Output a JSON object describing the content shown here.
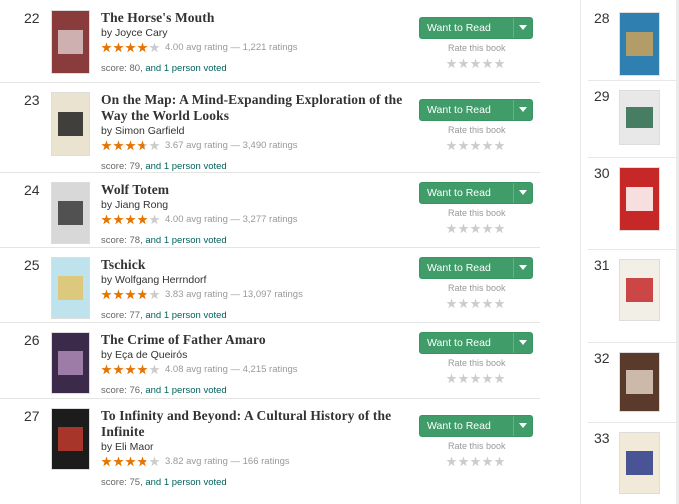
{
  "list": [
    {
      "rank": "22",
      "title": "The Horse's Mouth",
      "author": "Joyce Cary",
      "stars": 4.0,
      "rating_text": "4.00 avg rating — 1,221 ratings",
      "score": "score: 80,",
      "voted": "and 1 person voted",
      "want_label": "Want to Read",
      "rate_label": "Rate this book",
      "cover": {
        "bg": "#8a3b3b",
        "accent": "#d9c6c6",
        "text": "#ffffff"
      }
    },
    {
      "rank": "23",
      "title": "On the Map: A Mind-Expanding Exploration of the Way the World Looks",
      "author": "Simon Garfield",
      "stars": 3.67,
      "rating_text": "3.67 avg rating — 3,490 ratings",
      "score": "score: 79,",
      "voted": "and 1 person voted",
      "want_label": "Want to Read",
      "rate_label": "Rate this book",
      "cover": {
        "bg": "#e9e3cf",
        "accent": "#222222",
        "text": "#222222"
      }
    },
    {
      "rank": "24",
      "title": "Wolf Totem",
      "author": "Jiang Rong",
      "stars": 4.0,
      "rating_text": "4.00 avg rating — 3,277 ratings",
      "score": "score: 78,",
      "voted": "and 1 person voted",
      "want_label": "Want to Read",
      "rate_label": "Rate this book",
      "cover": {
        "bg": "#d8d8d8",
        "accent": "#3a3a3a",
        "text": "#ffffff"
      }
    },
    {
      "rank": "25",
      "title": "Tschick",
      "author": "Wolfgang Herrndorf",
      "stars": 3.83,
      "rating_text": "3.83 avg rating — 13,097 ratings",
      "score": "score: 77,",
      "voted": "and 1 person voted",
      "want_label": "Want to Read",
      "rate_label": "Rate this book",
      "cover": {
        "bg": "#bfe3ec",
        "accent": "#e0c46a",
        "text": "#222222"
      }
    },
    {
      "rank": "26",
      "title": "The Crime of Father Amaro",
      "author": "Eça de Queirós",
      "stars": 4.08,
      "rating_text": "4.08 avg rating — 4,215 ratings",
      "score": "score: 76,",
      "voted": "and 1 person voted",
      "want_label": "Want to Read",
      "rate_label": "Rate this book",
      "cover": {
        "bg": "#3b2a4a",
        "accent": "#b08bb8",
        "text": "#ffffff"
      }
    },
    {
      "rank": "27",
      "title": "To Infinity and Beyond: A Cultural History of the Infinite",
      "author": "Eli Maor",
      "stars": 3.82,
      "rating_text": "3.82 avg rating — 166 ratings",
      "score": "score: 75,",
      "voted": "and 1 person voted",
      "want_label": "Want to Read",
      "rate_label": "Rate this book",
      "cover": {
        "bg": "#1c1c1c",
        "accent": "#c0392b",
        "text": "#f0c040"
      }
    }
  ],
  "by_label": "by",
  "sidebar": [
    {
      "rank": "28",
      "cover": {
        "bg": "#2f7fb0",
        "accent": "#c9a15a"
      }
    },
    {
      "rank": "29",
      "cover": {
        "bg": "#e8e8e8",
        "accent": "#2a6a4a"
      }
    },
    {
      "rank": "30",
      "cover": {
        "bg": "#c62828",
        "accent": "#ffffff"
      }
    },
    {
      "rank": "31",
      "cover": {
        "bg": "#f2efe6",
        "accent": "#c62828"
      }
    },
    {
      "rank": "32",
      "cover": {
        "bg": "#5a3a2a",
        "accent": "#e0d0c0"
      }
    },
    {
      "rank": "33",
      "cover": {
        "bg": "#f2ead8",
        "accent": "#2a3a8a"
      }
    }
  ],
  "colors": {
    "star_on": "#e87400",
    "star_off": "#cccccc",
    "button": "#409d69",
    "link": "#00635d"
  }
}
